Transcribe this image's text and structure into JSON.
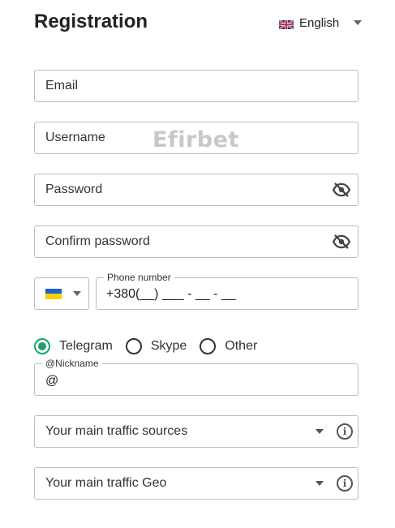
{
  "header": {
    "title": "Registration",
    "language": {
      "label": "English",
      "flag_icon": "uk-flag-icon"
    }
  },
  "fields": {
    "email": {
      "placeholder": "Email"
    },
    "username": {
      "placeholder": "Username"
    },
    "password": {
      "placeholder": "Password",
      "toggle_icon": "eye-off-icon"
    },
    "confirm_password": {
      "placeholder": "Confirm password",
      "toggle_icon": "eye-off-icon"
    }
  },
  "watermark": "Efirbet",
  "phone": {
    "country_flag_icon": "ukraine-flag-icon",
    "legend": "Phone number",
    "value": "+380(__) ___ - __ - __"
  },
  "messenger": {
    "options": [
      {
        "label": "Telegram",
        "selected": true
      },
      {
        "label": "Skype",
        "selected": false
      },
      {
        "label": "Other",
        "selected": false
      }
    ],
    "nickname_legend": "@Nickname",
    "nickname_value": "@"
  },
  "selects": {
    "traffic_sources": {
      "placeholder": "Your main traffic sources",
      "info_icon": "info-icon"
    },
    "traffic_geo": {
      "placeholder": "Your main traffic Geo",
      "info_icon": "info-icon"
    }
  },
  "colors": {
    "accent": "#1aa36b",
    "border": "#bdbdbd"
  }
}
